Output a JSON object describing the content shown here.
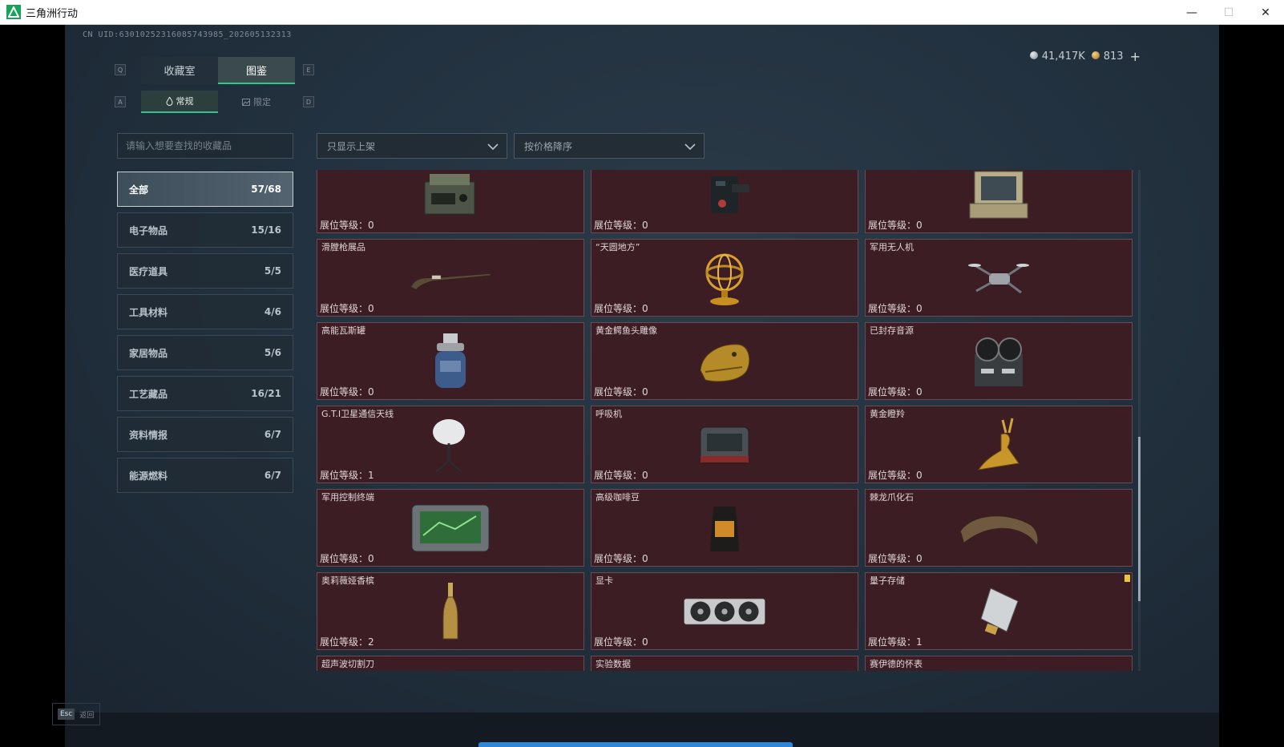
{
  "window": {
    "title": "三角洲行动",
    "minimize": "—",
    "maximize": "☐",
    "close": "✕"
  },
  "uid": "CN UID:6301025231608574398​5_202605132313",
  "currency": {
    "silver": "41,417K",
    "gold": "813",
    "plus": "+"
  },
  "keys": {
    "left_top": "Q",
    "right_top": "E",
    "left_sub": "A",
    "right_sub": "D"
  },
  "tabs": [
    {
      "label": "收藏室"
    },
    {
      "label": "图鉴"
    }
  ],
  "subtabs": [
    {
      "label": "常规"
    },
    {
      "label": "限定"
    }
  ],
  "search": {
    "placeholder": "请输入想要查找的收藏品"
  },
  "filters": {
    "filter": "只显示上架",
    "sort": "按价格降序"
  },
  "categories": [
    {
      "label": "全部",
      "count": "57/68"
    },
    {
      "label": "电子物品",
      "count": "15/16"
    },
    {
      "label": "医疗道具",
      "count": "5/5"
    },
    {
      "label": "工具材料",
      "count": "4/6"
    },
    {
      "label": "家居物品",
      "count": "5/6"
    },
    {
      "label": "工艺藏品",
      "count": "16/21"
    },
    {
      "label": "资料情报",
      "count": "6/7"
    },
    {
      "label": "能源燃料",
      "count": "6/7"
    }
  ],
  "level_label": "展位等级：",
  "items": [
    {
      "name": "",
      "level": "0",
      "icon": "radio-icon"
    },
    {
      "name": "",
      "level": "0",
      "icon": "device-icon"
    },
    {
      "name": "",
      "level": "0",
      "icon": "laptop-case-icon"
    },
    {
      "name": "滑膛枪展品",
      "level": "0",
      "icon": "musket-icon"
    },
    {
      "name": "“天圆地方”",
      "level": "0",
      "icon": "armillary-icon"
    },
    {
      "name": "军用无人机",
      "level": "0",
      "icon": "drone-icon"
    },
    {
      "name": "高能瓦斯罐",
      "level": "0",
      "icon": "gas-tank-icon"
    },
    {
      "name": "黄金鳄鱼头雕像",
      "level": "0",
      "icon": "croc-head-icon"
    },
    {
      "name": "已封存音源",
      "level": "0",
      "icon": "reel-recorder-icon"
    },
    {
      "name": "G.T.I卫星通信天线",
      "level": "1",
      "icon": "dish-icon"
    },
    {
      "name": "呼吸机",
      "level": "0",
      "icon": "ventilator-icon"
    },
    {
      "name": "黄金瞪羚",
      "level": "0",
      "icon": "gazelle-icon"
    },
    {
      "name": "军用控制终端",
      "level": "0",
      "icon": "terminal-icon"
    },
    {
      "name": "高级咖啡豆",
      "level": "0",
      "icon": "coffee-bag-icon"
    },
    {
      "name": "棘龙爪化石",
      "level": "0",
      "icon": "claw-icon"
    },
    {
      "name": "奥莉薇娅香槟",
      "level": "2",
      "icon": "champagne-icon"
    },
    {
      "name": "显卡",
      "level": "0",
      "icon": "gpu-icon"
    },
    {
      "name": "量子存储",
      "level": "1",
      "icon": "storage-icon",
      "badge": true
    },
    {
      "name": "超声波切割刀",
      "level": "",
      "icon": ""
    },
    {
      "name": "实验数据",
      "level": "",
      "icon": ""
    },
    {
      "name": "赛伊德的怀表",
      "level": "",
      "icon": ""
    }
  ],
  "esc": {
    "key": "Esc",
    "label": "返回"
  },
  "colors": {
    "accent": "#35c48a",
    "card_bg": "#3b1d23",
    "card_border": "#6b4a52"
  }
}
